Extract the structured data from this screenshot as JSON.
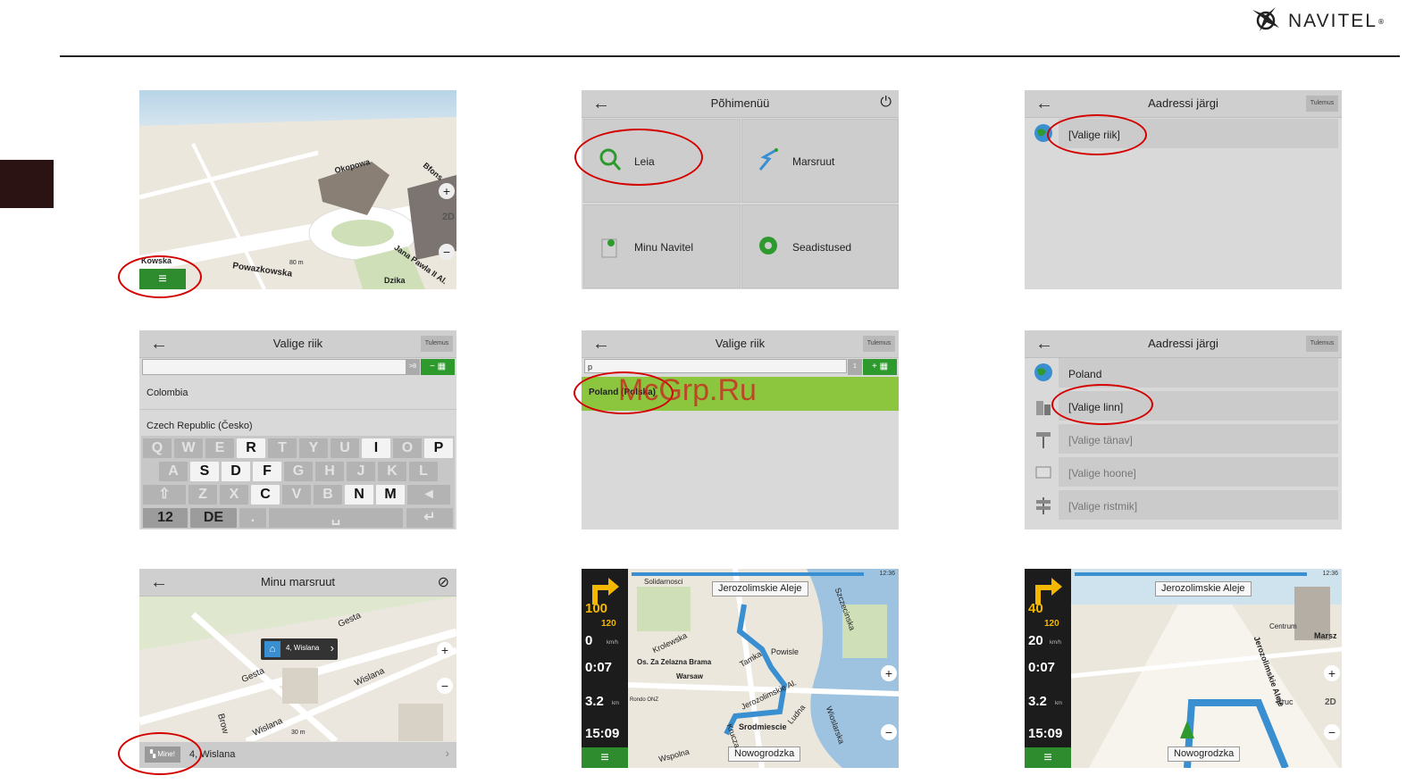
{
  "brand": {
    "name": "NAVITEL",
    "reg": "®"
  },
  "panel1": {
    "streets": [
      "Kowska",
      "Powazkowska",
      "Dzika",
      "Jana Pawla II Al.",
      "Okopowa",
      "Bfons"
    ],
    "scale": "80 m",
    "mode": "2D",
    "menu_icon": "hamburger-icon"
  },
  "panel2": {
    "title": "Põhimenüü",
    "tiles": [
      "Leia",
      "Marsruut",
      "Minu Navitel",
      "Seadistused"
    ]
  },
  "panel3": {
    "title": "Aadressi järgi",
    "result_btn": "Tulemus",
    "row": "[Valige riik]"
  },
  "panel4": {
    "title": "Valige riik",
    "result_btn": "Tulemus",
    "count": ">8",
    "items": [
      "Colombia",
      "Czech Republic (Česko)"
    ],
    "kb_rows": [
      [
        "Q",
        "W",
        "E",
        "R",
        "T",
        "Y",
        "U",
        "I",
        "O",
        "P"
      ],
      [
        "A",
        "S",
        "D",
        "F",
        "G",
        "H",
        "J",
        "K",
        "L"
      ],
      [
        "⇧",
        "Z",
        "X",
        "C",
        "V",
        "B",
        "N",
        "M",
        "◄"
      ]
    ],
    "kb_active": [
      "R",
      "I",
      "P",
      "S",
      "D",
      "F",
      "C",
      "N",
      "M"
    ],
    "kb_bottom": [
      "12",
      "DE",
      ".",
      "␣",
      "↵"
    ]
  },
  "panel5": {
    "title": "Valige riik",
    "result_btn": "Tulemus",
    "query": "p",
    "count": "1",
    "item": "Poland (Polska)"
  },
  "panel6": {
    "title": "Aadressi järgi",
    "result_btn": "Tulemus",
    "rows": [
      "Poland",
      "[Valige linn]",
      "[Valige tänav]",
      "[Valige hoone]",
      "[Valige ristmik]"
    ]
  },
  "panel7": {
    "title": "Minu marsruut",
    "popup": "4, Wislana",
    "streets": [
      "Gesta",
      "Gesta",
      "Wislana",
      "Wislana",
      "Brow"
    ],
    "scale": "30 m",
    "bottom_label": "4, Wislana",
    "mine_btn": "Mine!"
  },
  "panel8": {
    "speed_limit": "100",
    "dist_turn": "120",
    "speed": "0",
    "speed_unit": "km/h",
    "eta": "0:07",
    "dist": "3.2",
    "dist_unit": "km",
    "time": "15:09",
    "street_top": "Jerozolimskie Aleje",
    "street_bottom": "Nowogrodzka",
    "labels": [
      "Solidarnosci",
      "Krolewska",
      "Os. Za Zelazna Brama",
      "Warsaw",
      "Tamka",
      "Powisle",
      "Jerozolimskie Al.",
      "Ludna",
      "Srodmiescie",
      "Wspolna",
      "Krucza",
      "Wioslarska",
      "Szczecinska",
      "Rondo ONZ"
    ],
    "clock": "12:36"
  },
  "panel9": {
    "speed_limit": "40",
    "dist_turn": "120",
    "speed": "20",
    "speed_unit": "km/h",
    "eta": "0:07",
    "dist": "3.2",
    "dist_unit": "km",
    "time": "15:09",
    "street_top": "Jerozolimskie Aleje",
    "street_bottom": "Nowogrodzka",
    "labels": [
      "Centrum",
      "Marsz",
      "Jerozolimskie Aleje",
      "Kruc",
      "2D"
    ],
    "clock": "12:36"
  },
  "watermark": "McGrp.Ru"
}
